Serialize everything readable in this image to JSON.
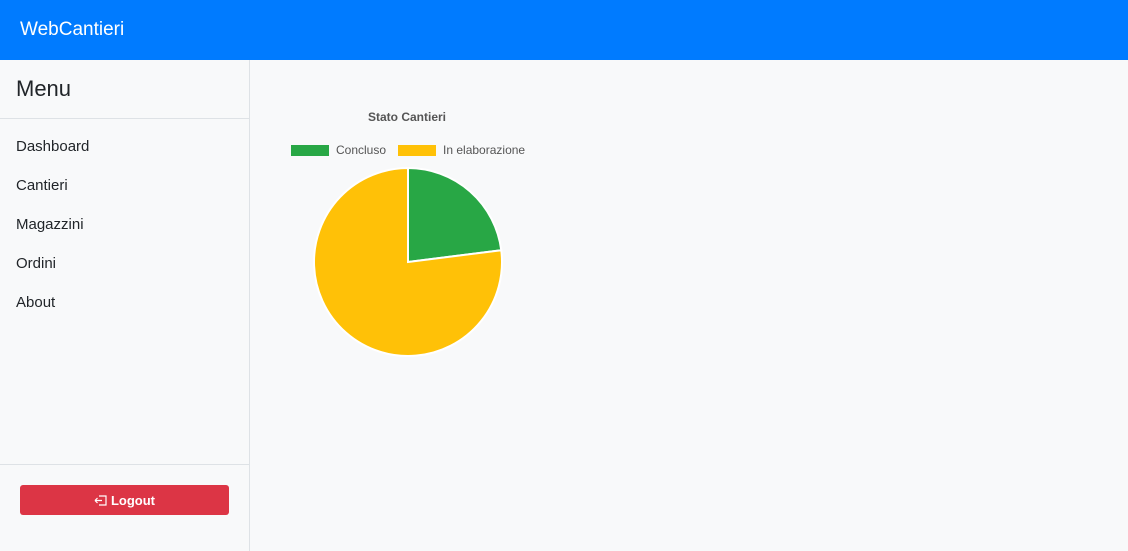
{
  "app": {
    "brand": "WebCantieri"
  },
  "sidebar": {
    "title": "Menu",
    "items": [
      {
        "label": "Dashboard"
      },
      {
        "label": "Cantieri"
      },
      {
        "label": "Magazzini"
      },
      {
        "label": "Ordini"
      },
      {
        "label": "About"
      }
    ],
    "logout_label": "Logout",
    "logout_icon": "logout-icon"
  },
  "colors": {
    "primary": "#007bff",
    "danger": "#dc3545",
    "success": "#28a745",
    "warning": "#ffc107"
  },
  "chart_data": {
    "type": "pie",
    "title": "Stato Cantieri",
    "categories": [
      "Concluso",
      "In elaborazione"
    ],
    "values": [
      23,
      77
    ],
    "colors": [
      "#28a745",
      "#ffc107"
    ],
    "legend": "top"
  }
}
